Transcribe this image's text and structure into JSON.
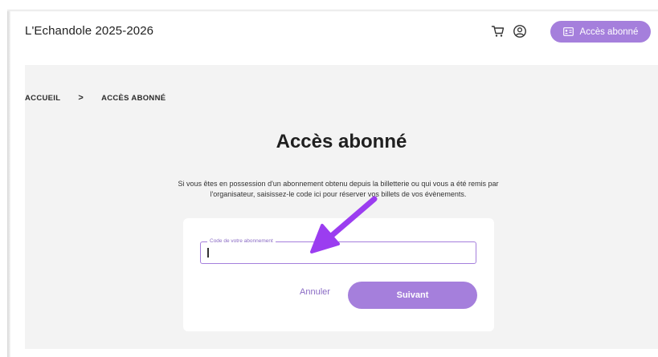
{
  "header": {
    "site_title": "L'Echandole 2025-2026",
    "cart_icon": "cart-icon",
    "account_icon": "account-icon",
    "subscriber_button_label": "Accès abonné",
    "subscriber_button_icon": "id-card-icon"
  },
  "breadcrumb": {
    "items": [
      "ACCUEIL",
      "ACCÈS ABONNÉ"
    ],
    "separator": ">"
  },
  "page": {
    "title": "Accès abonné",
    "intro_line1": "Si vous êtes en possession d'un abonnement obtenu depuis la billetterie ou qui vous a été remis par",
    "intro_line2": "l'organisateur, saisissez-le code ici pour réserver vos billets de vos évènements."
  },
  "form": {
    "code_label": "Code de votre abonnement",
    "code_value": "",
    "cancel_label": "Annuler",
    "next_label": "Suivant"
  },
  "colors": {
    "accent": "#a57fdc",
    "arrow": "#9b3df0",
    "main_background": "#f3f3f3"
  }
}
